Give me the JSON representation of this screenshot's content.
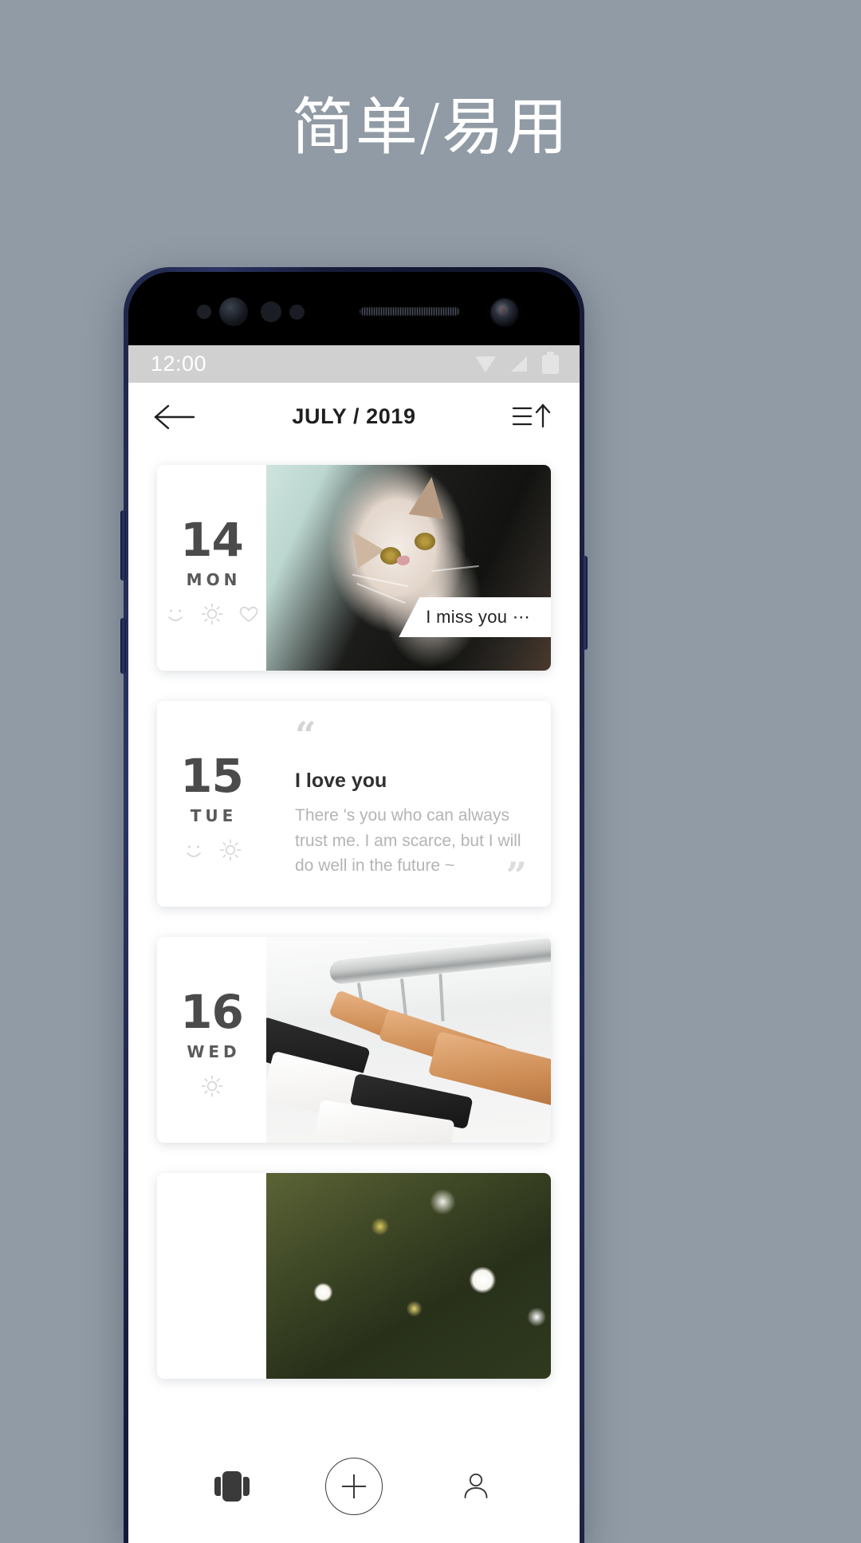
{
  "promo": {
    "headline": "简单/易用"
  },
  "phone": {
    "status_bar": {
      "time": "12:00",
      "icons": [
        "wifi-icon",
        "signal-icon",
        "battery-icon"
      ]
    },
    "app": {
      "header": {
        "back_icon": "back-arrow-icon",
        "title": "JULY / 2019",
        "sort_icon": "sort-ascending-icon"
      },
      "entries": [
        {
          "day": "14",
          "weekday": "MON",
          "moods": [
            "smiley-icon",
            "sun-icon",
            "heart-icon"
          ],
          "media": "photo-cat",
          "tag": "I miss you ⋯"
        },
        {
          "day": "15",
          "weekday": "TUE",
          "moods": [
            "smiley-icon",
            "sun-icon"
          ],
          "media": "quote",
          "quote_open": "“",
          "quote_close": "”",
          "quote_title": "I love you",
          "quote_text": "There 's you who can always trust me. I am scarce, but I will do well in the future ~"
        },
        {
          "day": "16",
          "weekday": "WED",
          "moods": [
            "sun-icon"
          ],
          "media": "photo-clothes"
        },
        {
          "day": "",
          "weekday": "",
          "moods": [],
          "media": "photo-flowers"
        }
      ],
      "bottom_nav": [
        {
          "icon": "cards-icon",
          "active": true
        },
        {
          "icon": "add-circle-icon",
          "active": false
        },
        {
          "icon": "person-icon",
          "active": false
        }
      ]
    }
  },
  "colors": {
    "background": "#919ba5",
    "phone_frame": "#1b2345",
    "status_bar": "#d0d0d0",
    "text_primary": "#1f1f1f",
    "text_muted": "#b4b4b4",
    "day_number": "#4b4b4b"
  }
}
